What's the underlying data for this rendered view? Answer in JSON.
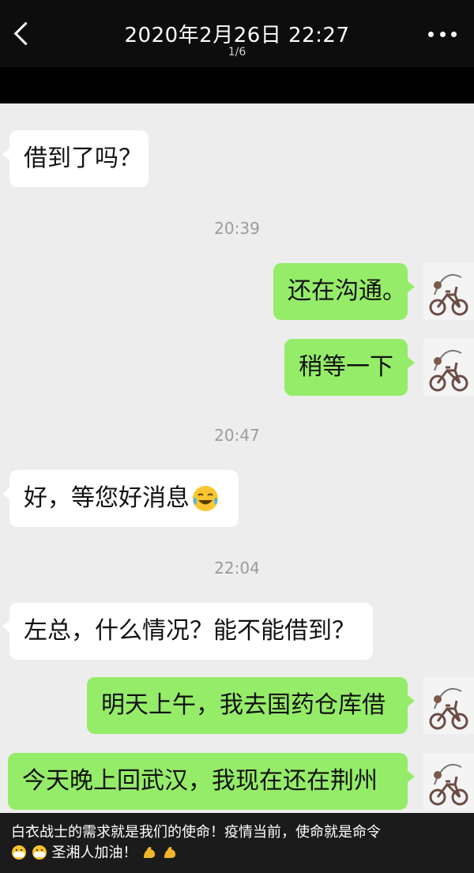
{
  "header": {
    "title": "2020年2月26日 22:27",
    "page_indicator": "1/6"
  },
  "messages": [
    {
      "id": "m1",
      "side": "in",
      "text": "借到了吗？"
    },
    {
      "id": "t1",
      "type": "time",
      "text": "20:39"
    },
    {
      "id": "m2",
      "side": "out",
      "text": "还在沟通。"
    },
    {
      "id": "m3",
      "side": "out",
      "text": "稍等一下"
    },
    {
      "id": "t2",
      "type": "time",
      "text": "20:47"
    },
    {
      "id": "m4",
      "side": "in",
      "text": "好，等您好消息",
      "emoji": "tears-of-joy-emoji"
    },
    {
      "id": "t3",
      "type": "time",
      "text": "22:04"
    },
    {
      "id": "m5",
      "side": "in",
      "text": "左总，什么情况？能不能借到？"
    },
    {
      "id": "m6",
      "side": "out",
      "text": "明天上午，我去国药仓库借"
    },
    {
      "id": "m7",
      "side": "out",
      "text": "今天晚上回武汉，我现在还在荆州"
    }
  ],
  "caption": {
    "line1": "白衣战士的需求就是我们的使命！疫情当前，使命就是命令",
    "line2": "圣湘人加油！",
    "emojis": [
      "mask-face-emoji",
      "mask-face-emoji",
      "flexed-biceps-emoji",
      "flexed-biceps-emoji"
    ]
  },
  "colors": {
    "header_bg": "#0d0d0d",
    "chat_bg": "#ededed",
    "incoming_bubble": "#ffffff",
    "outgoing_bubble": "#95ec69",
    "time_text": "#9b9b9b",
    "caption_bg": "#1b1b1b"
  },
  "avatar": {
    "icon": "bicycle-avatar-icon"
  }
}
